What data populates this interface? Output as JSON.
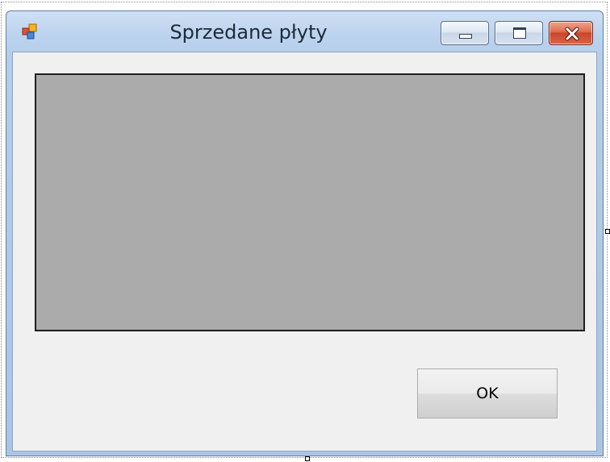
{
  "window": {
    "title": "Sprzedane płyty",
    "icon": "app-form-icon"
  },
  "controls": {
    "minimize_icon": "minimize-icon",
    "maximize_icon": "maximize-icon",
    "close_icon": "close-icon"
  },
  "form": {
    "ok_label": "OK"
  },
  "colors": {
    "client_background": "#f0f0f0",
    "grid_background": "#ababab",
    "close_button": "#d9654a"
  }
}
